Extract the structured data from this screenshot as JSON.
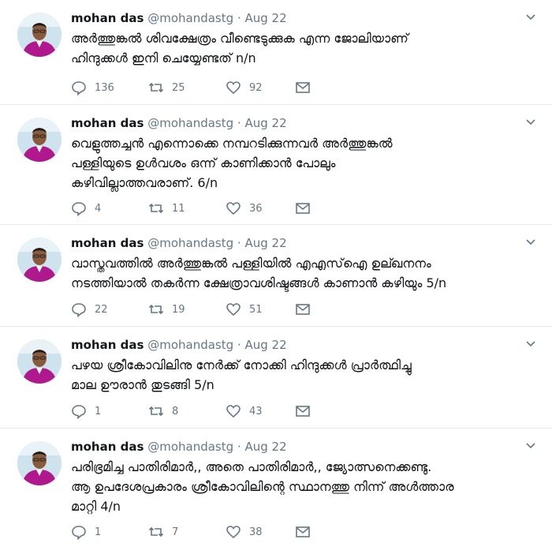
{
  "author": {
    "name": "mohan das",
    "handle": "@mohandastg",
    "separator": "·"
  },
  "tweets": [
    {
      "date": "Aug 22",
      "text": "അർത്തുങ്കൽ ശിവക്ഷേത്രം വീണ്ടെടുക്കുക എന്ന ജോലിയാണ്\nഹിന്ദുക്കൾ ഇനി ചെയ്യേണ്ടത് n/n",
      "replies": "136",
      "retweets": "25",
      "likes": "92"
    },
    {
      "date": "Aug 22",
      "text": "വെളുത്തച്ചൻ എന്നൊക്കെ നമ്പറടിക്കുന്നവർ അർത്തുങ്കൽ\nപള്ളിയുടെ ഉൾവശം ഒന്ന് കാണിക്കാൻ പോലും\nകഴിവില്ലാത്തവരാണ്. 6/n",
      "replies": "4",
      "retweets": "11",
      "likes": "36"
    },
    {
      "date": "Aug 22",
      "text": "വാസ്തവത്തിൽ അർത്തുങ്കൽ പള്ളിയിൽ എഎസ്ഐ ഉല്ഖനനം\nനടത്തിയാൽ തകർന്ന ക്ഷേത്രാവശിഷ്ടങ്ങൾ കാണാൻ കഴിയും 5/n",
      "replies": "22",
      "retweets": "19",
      "likes": "51"
    },
    {
      "date": "Aug 22",
      "text": "പഴയ ശ്രീകോവിലിനു നേർക്ക് നോക്കി ഹിന്ദുക്കൾ പ്രാർത്ഥിച്ചു\nമാല ഊരാൻ തുടങ്ങി 5/n",
      "replies": "1",
      "retweets": "8",
      "likes": "43"
    },
    {
      "date": "Aug 22",
      "text": "പരിഭ്രമിച്ച പാതിരിമാർ,, അതെ പാതിരിമാർ,, ജ്യോത്സനെക്കണ്ടു.\nആ ഉപദേശപ്രകാരം ശ്രീകോവിലിന്റെ സ്ഥാനത്തു നിന്ന് അൾത്താര\nമാറ്റി 4/n",
      "replies": "1",
      "retweets": "7",
      "likes": "38"
    }
  ],
  "icons": {
    "reply": "reply-icon",
    "retweet": "retweet-icon",
    "like": "heart-icon",
    "dm": "envelope-icon",
    "caret": "chevron-down-icon"
  },
  "colors": {
    "muted": "#657786",
    "avatar_shirt": "#b0198e",
    "avatar_bg": "#cfe3ef"
  }
}
